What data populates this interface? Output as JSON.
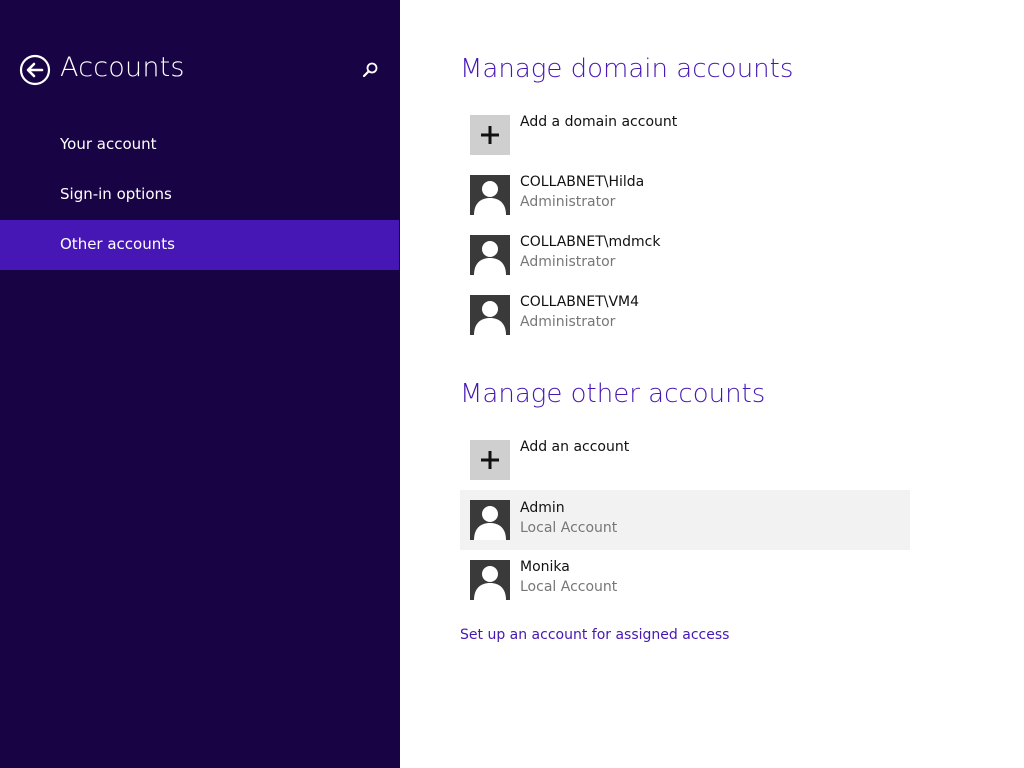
{
  "sidebar": {
    "title": "Accounts",
    "items": [
      {
        "label": "Your account"
      },
      {
        "label": "Sign-in options"
      },
      {
        "label": "Other accounts"
      }
    ]
  },
  "domain_section": {
    "title": "Manage domain accounts",
    "add_label": "Add a domain account",
    "accounts": [
      {
        "name": "COLLABNET\\Hilda",
        "role": "Administrator"
      },
      {
        "name": "COLLABNET\\mdmck",
        "role": "Administrator"
      },
      {
        "name": "COLLABNET\\VM4",
        "role": "Administrator"
      }
    ]
  },
  "other_section": {
    "title": "Manage other accounts",
    "add_label": "Add an account",
    "accounts": [
      {
        "name": "Admin",
        "role": "Local Account"
      },
      {
        "name": "Monika",
        "role": "Local Account"
      }
    ]
  },
  "assigned_access_link": "Set up an account for assigned access",
  "colors": {
    "sidebar_bg": "#180445",
    "accent": "#4617b4",
    "selected_item_bg": "#4617b4"
  },
  "icons": [
    "back-arrow-icon",
    "search-icon",
    "plus-icon",
    "user-icon"
  ]
}
